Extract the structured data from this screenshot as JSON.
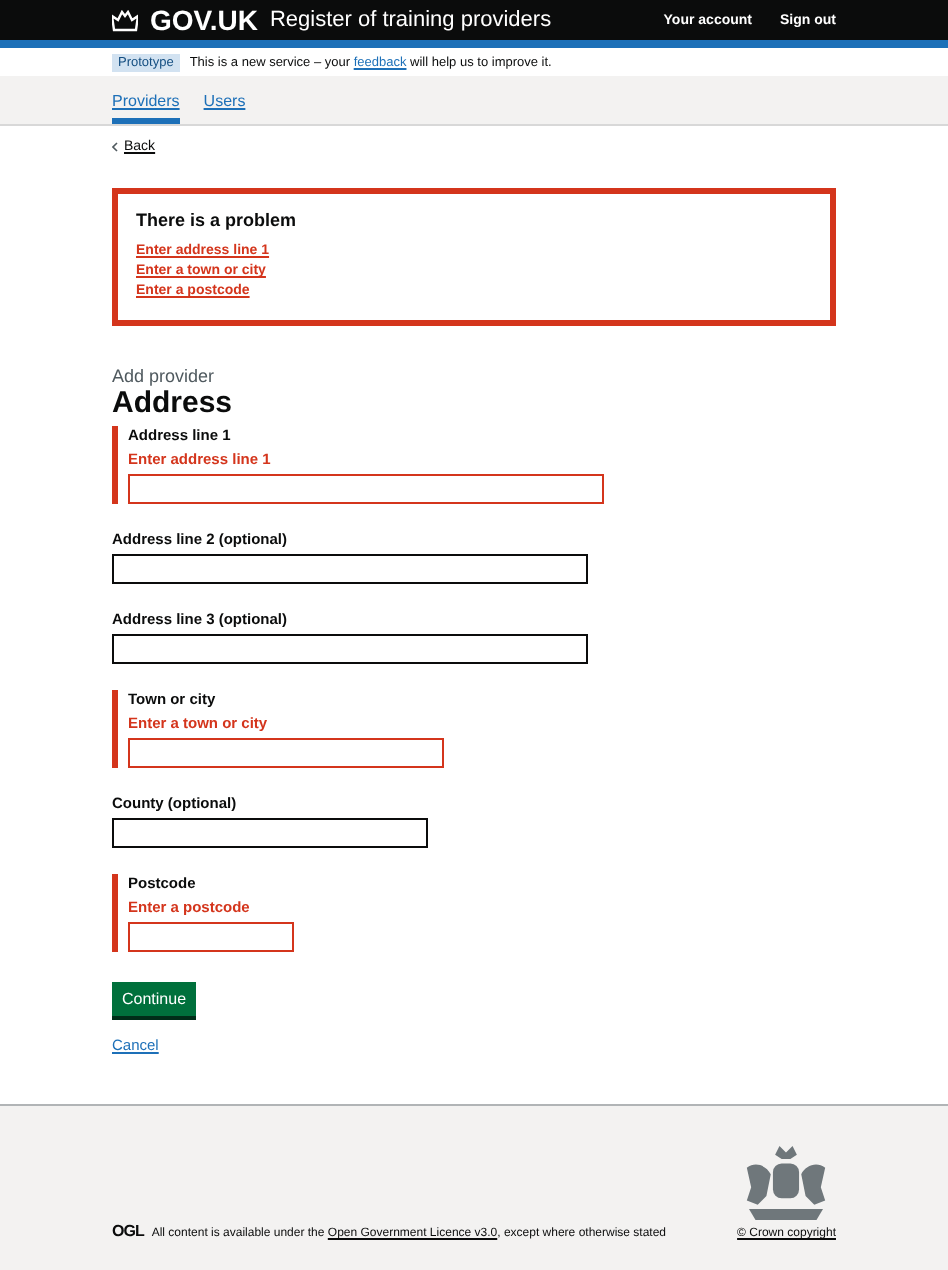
{
  "header": {
    "logo_text": "GOV.UK",
    "service_name": "Register of training providers",
    "links": [
      "Your account",
      "Sign out"
    ]
  },
  "phase_banner": {
    "tag": "Prototype",
    "text_before": "This is a new service – your",
    "link": "feedback",
    "text_after": "will help us to improve it."
  },
  "nav": [
    {
      "label": "Providers",
      "selected": true
    },
    {
      "label": "Users",
      "selected": false
    }
  ],
  "back_link": "Back",
  "error_summary": {
    "title": "There is a problem",
    "errors": [
      "Enter address line 1",
      "Enter a town or city",
      "Enter a postcode"
    ]
  },
  "caption": "Add provider",
  "heading": "Address",
  "fields": [
    {
      "kind": "long",
      "label": "Address line 1",
      "error": "Enter address line 1"
    },
    {
      "kind": "long",
      "label": "Address line 2 (optional)"
    },
    {
      "kind": "long",
      "label": "Address line 3 (optional)"
    },
    {
      "kind": "medium",
      "label": "Town or city",
      "error": "Enter a town or city"
    },
    {
      "kind": "medium",
      "label": "County (optional)"
    },
    {
      "kind": "short",
      "label": "Postcode",
      "error": "Enter a postcode"
    }
  ],
  "continue_button": "Continue",
  "cancel_link": "Cancel",
  "footer": {
    "ogl": "OGL",
    "licence_before": "All content is available under the",
    "licence_link": "Open Government Licence v3.0",
    "licence_after": ", except where otherwise stated",
    "copyright": "© Crown copyright"
  }
}
